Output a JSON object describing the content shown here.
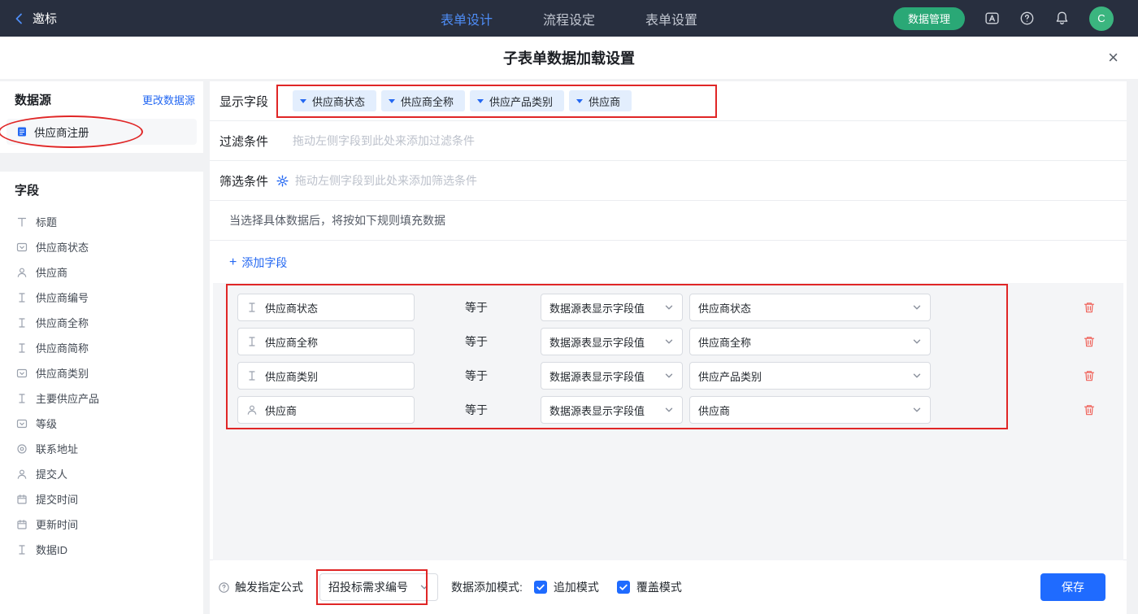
{
  "topbar": {
    "back_label": "邀标",
    "tabs": [
      {
        "label": "表单设计",
        "active": true
      },
      {
        "label": "流程设定",
        "active": false
      },
      {
        "label": "表单设置",
        "active": false
      }
    ],
    "data_manage_button": "数据管理",
    "avatar_initial": "C"
  },
  "modal": {
    "title": "子表单数据加载设置",
    "close_glyph": "×"
  },
  "sidebar": {
    "datasource": {
      "title": "数据源",
      "change_link": "更改数据源",
      "selected": "供应商注册"
    },
    "fields": {
      "title": "字段",
      "items": [
        {
          "label": "标题",
          "icon": "title"
        },
        {
          "label": "供应商状态",
          "icon": "select"
        },
        {
          "label": "供应商",
          "icon": "user"
        },
        {
          "label": "供应商编号",
          "icon": "input"
        },
        {
          "label": "供应商全称",
          "icon": "input"
        },
        {
          "label": "供应商简称",
          "icon": "input"
        },
        {
          "label": "供应商类别",
          "icon": "select"
        },
        {
          "label": "主要供应产品",
          "icon": "input"
        },
        {
          "label": "等级",
          "icon": "select"
        },
        {
          "label": "联系地址",
          "icon": "location"
        },
        {
          "label": "提交人",
          "icon": "user"
        },
        {
          "label": "提交时间",
          "icon": "date"
        },
        {
          "label": "更新时间",
          "icon": "date"
        },
        {
          "label": "数据ID",
          "icon": "input"
        }
      ]
    }
  },
  "main": {
    "display_fields": {
      "label": "显示字段",
      "tags": [
        "供应商状态",
        "供应商全称",
        "供应产品类别",
        "供应商"
      ]
    },
    "filter": {
      "label": "过滤条件",
      "placeholder": "拖动左侧字段到此处来添加过滤条件"
    },
    "screen": {
      "label": "筛选条件",
      "placeholder": "拖动左侧字段到此处来添加筛选条件"
    },
    "rules": {
      "hint": "当选择具体数据后，将按如下规则填充数据",
      "add_plus": "+",
      "add_field": "添加字段",
      "operator": "等于",
      "rows": [
        {
          "field": "供应商状态",
          "icon": "input",
          "source": "数据源表显示字段值",
          "value": "供应商状态"
        },
        {
          "field": "供应商全称",
          "icon": "input",
          "source": "数据源表显示字段值",
          "value": "供应商全称"
        },
        {
          "field": "供应商类别",
          "icon": "input",
          "source": "数据源表显示字段值",
          "value": "供应产品类别"
        },
        {
          "field": "供应商",
          "icon": "user",
          "source": "数据源表显示字段值",
          "value": "供应商"
        }
      ]
    },
    "footer": {
      "formula_label": "触发指定公式",
      "formula_value": "招投标需求编号",
      "mode_label": "数据添加模式:",
      "modes": [
        {
          "label": "追加模式",
          "checked": true
        },
        {
          "label": "覆盖模式",
          "checked": true
        }
      ],
      "save": "保存"
    }
  },
  "colors": {
    "topbar_bg": "#282f3f",
    "primary_blue": "#1f6bff",
    "link_blue": "#2468f2",
    "green_button": "#2aa876",
    "avatar_green": "#3bb57f",
    "tag_bg": "#e3eefd",
    "danger_red": "#ef6058",
    "annotation_red": "#e02626"
  }
}
